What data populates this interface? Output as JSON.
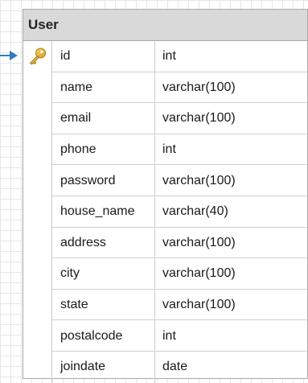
{
  "table": {
    "title": "User",
    "columns": [
      {
        "name": "id",
        "type": "int",
        "primary_key": true
      },
      {
        "name": "name",
        "type": "varchar(100)"
      },
      {
        "name": "email",
        "type": "varchar(100)"
      },
      {
        "name": "phone",
        "type": "int"
      },
      {
        "name": "password",
        "type": "varchar(100)"
      },
      {
        "name": "house_name",
        "type": "varchar(40)"
      },
      {
        "name": "address",
        "type": "varchar(100)"
      },
      {
        "name": "city",
        "type": "varchar(100)"
      },
      {
        "name": "state",
        "type": "varchar(100)"
      },
      {
        "name": "postalcode",
        "type": "int"
      },
      {
        "name": "joindate",
        "type": "date"
      }
    ]
  },
  "icons": {
    "primary_key": "key-icon",
    "current_row": "arrow-right-icon"
  },
  "colors": {
    "header_bg": "#d9d9d9",
    "key_gold": "#e3b03a",
    "arrow_blue": "#2f7cc4"
  }
}
